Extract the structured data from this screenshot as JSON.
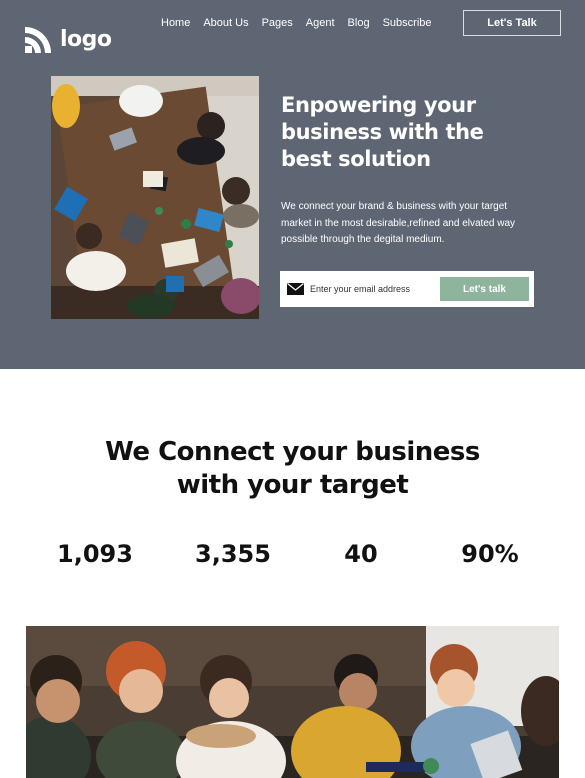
{
  "brand": {
    "logo_text": "logo"
  },
  "nav": {
    "items": [
      {
        "label": "Home"
      },
      {
        "label": "About Us"
      },
      {
        "label": "Pages"
      },
      {
        "label": "Agent"
      },
      {
        "label": "Blog"
      },
      {
        "label": "Subscribe"
      }
    ],
    "cta_label": "Let's Talk"
  },
  "hero": {
    "title_lines": [
      "Enpowering your",
      "business with the",
      "best solution"
    ],
    "description_lines": [
      "We connect your brand & business with your target",
      "market in the most desirable,refined and elvated way",
      "possible through the degital medium."
    ],
    "email_placeholder": "Enter your email address",
    "email_value": "",
    "submit_label": "Let's talk"
  },
  "connect": {
    "title_lines": [
      "We Connect your business",
      "with your target"
    ],
    "stats": [
      {
        "value": "1,093"
      },
      {
        "value": "3,355"
      },
      {
        "value": "40"
      },
      {
        "value": "90%"
      }
    ]
  },
  "colors": {
    "hero_bg": "#5f6673",
    "accent_green": "#8fb49d"
  },
  "icons": {
    "logo": "logo-stripes-icon",
    "mail": "envelope-icon"
  }
}
